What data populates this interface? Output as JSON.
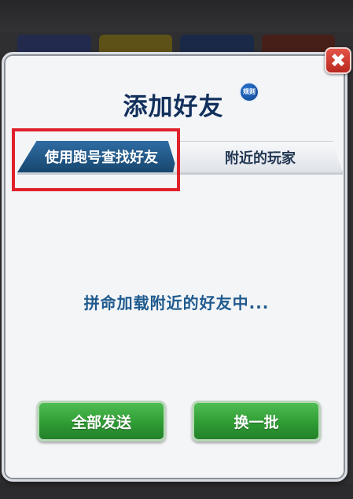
{
  "dialog": {
    "title": "添加好友",
    "rules_badge": "规则",
    "close_icon": "close-icon",
    "close_glyph": "✖"
  },
  "tabs": [
    {
      "label": "使用跑号查找好友",
      "active": true
    },
    {
      "label": "附近的玩家",
      "active": false
    }
  ],
  "status": {
    "loading_text": "拼命加载附近的好友中..."
  },
  "actions": {
    "send_all_label": "全部发送",
    "refresh_label": "换一批"
  },
  "colors": {
    "title": "#12305c",
    "active_tab": "#1f5a8e",
    "button_green": "#2f9c34",
    "close_red": "#d23a2f",
    "highlight": "#e0212c"
  }
}
